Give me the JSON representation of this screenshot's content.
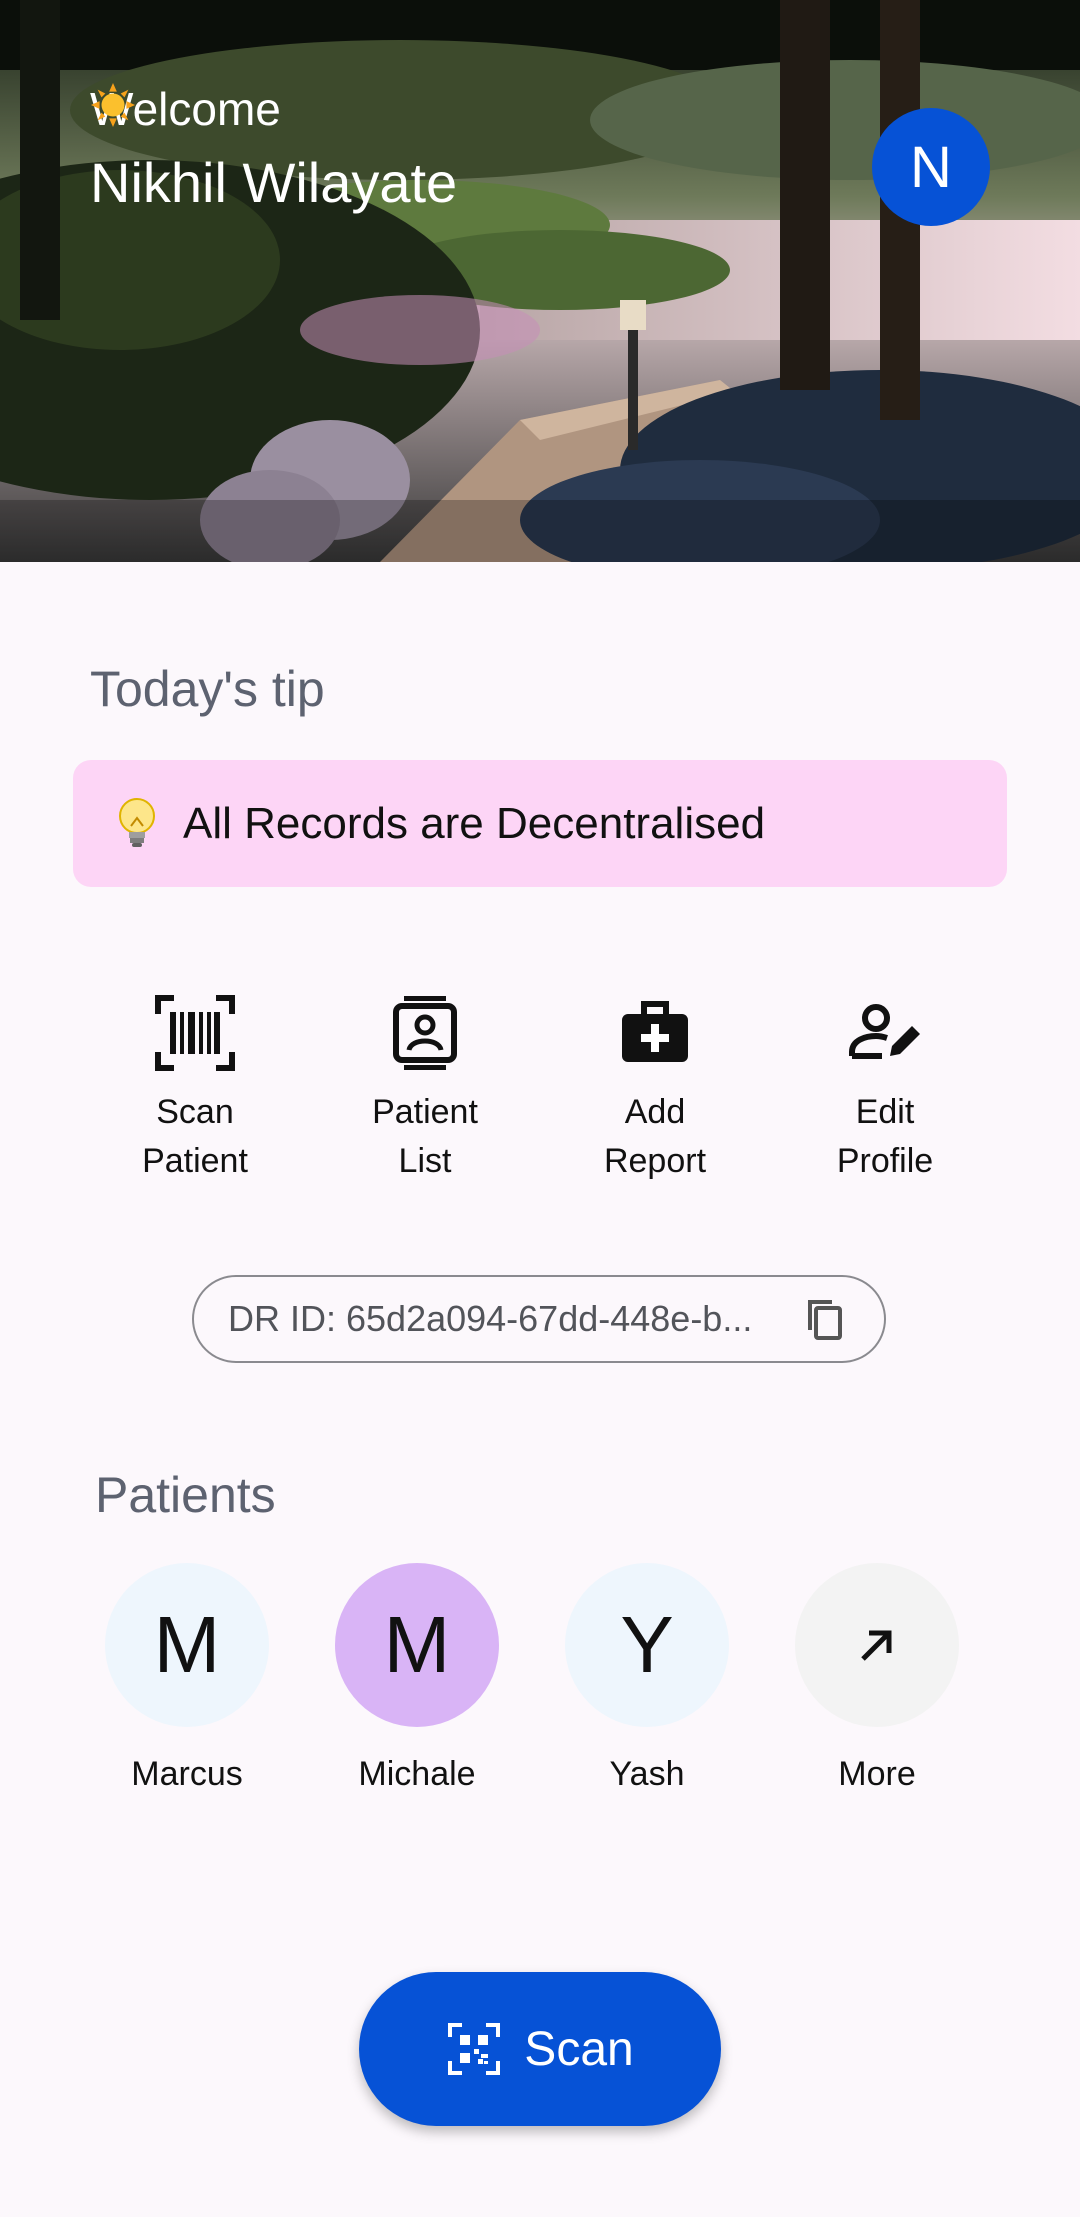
{
  "header": {
    "welcome": "Welcome",
    "user_name": "Nikhil Wilayate",
    "avatar_initial": "N",
    "welcome_icon": "sun-emoji",
    "background": "park-landscape-illustration"
  },
  "tip": {
    "title": "Today's tip",
    "icon": "lightbulb-emoji",
    "text": "All Records are Decentralised"
  },
  "actions": [
    {
      "label_line1": "Scan",
      "label_line2": "Patient",
      "icon": "barcode-scan-icon"
    },
    {
      "label_line1": "Patient",
      "label_line2": "List",
      "icon": "contact-list-icon"
    },
    {
      "label_line1": "Add",
      "label_line2": "Report",
      "icon": "medical-bag-icon"
    },
    {
      "label_line1": "Edit",
      "label_line2": "Profile",
      "icon": "edit-profile-icon"
    }
  ],
  "doctor_id": {
    "text": "DR ID: 65d2a094-67dd-448e-b...",
    "icon": "copy-icon"
  },
  "patients": {
    "title": "Patients",
    "items": [
      {
        "initial": "M",
        "name": "Marcus",
        "color": "#eef6fd"
      },
      {
        "initial": "M",
        "name": "Michale",
        "color": "#d9b4f6"
      },
      {
        "initial": "Y",
        "name": "Yash",
        "color": "#eef6fd"
      }
    ],
    "more": {
      "label": "More",
      "icon": "arrow-up-right-icon",
      "color": "#f3f3f3"
    }
  },
  "scan_button": {
    "label": "Scan",
    "icon": "qr-scan-icon"
  },
  "colors": {
    "primary": "#0652d6",
    "tip_background": "#fdd5f6",
    "page_background": "#fcf8fc"
  }
}
